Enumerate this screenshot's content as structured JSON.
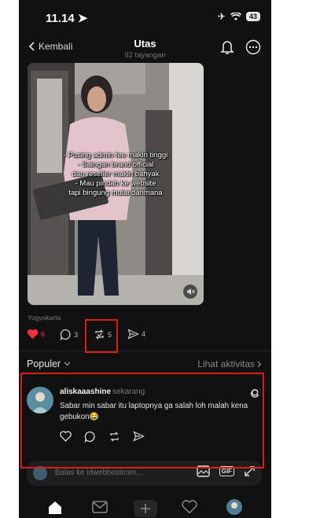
{
  "status": {
    "time": "11.14",
    "battery": "43"
  },
  "header": {
    "back_label": "Kembali",
    "title": "Utas",
    "views": "92 tayangan"
  },
  "post": {
    "overlay_lines": [
      "- Pusing admin fee makin tinggi",
      "- Saingan brand official",
      "dan reseller makin banyak",
      "- Mau pindah ke website",
      "tapi bingung mulai darimana"
    ],
    "location": "Yogyakarta",
    "likes": "6",
    "comments": "3",
    "reposts": "5",
    "shares": "4"
  },
  "section": {
    "sort_label": "Populer",
    "activity_link": "Lihat aktivitas"
  },
  "comment": {
    "username": "aliskaaashine",
    "time": "sekarang",
    "text": "Sabar min sabar itu laptopnya ga salah loh malah kena gebukon😂"
  },
  "reply": {
    "placeholder": "Balas ke idwebhostcom..."
  },
  "colors": {
    "background": "#101010",
    "like": "#ff3040",
    "highlight": "#e01b1b",
    "text": "#f5f5f5",
    "muted": "#777777"
  }
}
